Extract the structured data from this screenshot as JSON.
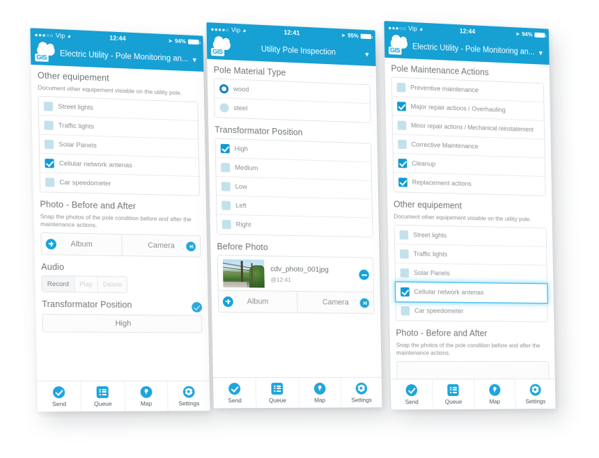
{
  "theme": {
    "brand_blue": "#16a0d4",
    "accent_blue": "#1fa5dd",
    "checkbox_on": "#0f9ad4",
    "checkbox_off": "#c3e1ec",
    "focus_glow": "#4fc3ef",
    "page_background": "#ffffff",
    "label_gray": "#8a9094"
  },
  "tabbar": {
    "items": [
      {
        "label": "Send",
        "icon": "check-circle-icon"
      },
      {
        "label": "Queue",
        "icon": "list-icon"
      },
      {
        "label": "Map",
        "icon": "map-pin-icon"
      },
      {
        "label": "Settings",
        "icon": "gear-icon"
      }
    ]
  },
  "phone1": {
    "statusbar": {
      "signal_dots": "●●●○○",
      "carrier": "Vip",
      "wifi_icon": "wifi-icon",
      "time": "12:44",
      "location_icon": "location-arrow-icon",
      "battery_percent": "94%"
    },
    "navbar": {
      "logo": "gis-cloud-logo",
      "logo_text": "GIS",
      "title": "Electric Utility - Pole Monitoring an...",
      "chevron": "chevron-down-icon"
    },
    "other_equipment": {
      "title": "Other equipement",
      "subtitle": "Document other equipement visiable on the utility pole.",
      "items": [
        {
          "label": "Street lights",
          "checked": false
        },
        {
          "label": "Traffic lights",
          "checked": false
        },
        {
          "label": "Solar Panels",
          "checked": false
        },
        {
          "label": "Cellular network antenas",
          "checked": true
        },
        {
          "label": "Car speedometer",
          "checked": false
        }
      ]
    },
    "photo": {
      "title": "Photo - Before and After",
      "subtitle": "Snap the photos of the pole condition before and after the maintenance actions.",
      "album_label": "Album",
      "album_icon": "plus-circle-icon",
      "camera_label": "Camera",
      "camera_icon": "camera-icon"
    },
    "audio": {
      "title": "Audio",
      "record_label": "Record",
      "play_label": "Play",
      "delete_label": "Delete"
    },
    "transformator": {
      "title": "Transformator Position",
      "status_icon": "check-circle-icon",
      "value": "High"
    }
  },
  "phone2": {
    "statusbar": {
      "signal_dots": "●●●●○",
      "carrier": "Vip",
      "wifi_icon": "wifi-icon",
      "time": "12:41",
      "location_icon": "location-arrow-icon",
      "battery_percent": "95%"
    },
    "navbar": {
      "logo": "gis-cloud-logo",
      "logo_text": "GIS",
      "title": "Utility Pole Inspection",
      "chevron": "chevron-down-icon"
    },
    "pole_material": {
      "title": "Pole Material Type",
      "items": [
        {
          "label": "wood",
          "selected": true
        },
        {
          "label": "steel",
          "selected": false
        }
      ]
    },
    "transformator": {
      "title": "Transformator Position",
      "items": [
        {
          "label": "High",
          "checked": true
        },
        {
          "label": "Medium",
          "checked": false
        },
        {
          "label": "Low",
          "checked": false
        },
        {
          "label": "Left",
          "checked": false
        },
        {
          "label": "Right",
          "checked": false
        }
      ]
    },
    "before_photo": {
      "title": "Before Photo",
      "thumbnail": "utility-pole-photo-thumbnail",
      "filename": "cdv_photo_001jpg",
      "timestamp": "@12:41",
      "remove_icon": "minus-circle-icon",
      "album_label": "Album",
      "album_icon": "plus-circle-icon",
      "camera_label": "Camera",
      "camera_icon": "camera-icon"
    }
  },
  "phone3": {
    "statusbar": {
      "signal_dots": "●●●○○",
      "carrier": "Vip",
      "wifi_icon": "wifi-icon",
      "time": "12:44",
      "location_icon": "location-arrow-icon",
      "battery_percent": "94%"
    },
    "navbar": {
      "logo": "gis-cloud-logo",
      "logo_text": "GIS",
      "title": "Electric Utility - Pole Monitoring an...",
      "chevron": "chevron-down-icon"
    },
    "maintenance": {
      "title": "Pole Maintenance Actions",
      "items": [
        {
          "label": "Preventive maintenance",
          "checked": false
        },
        {
          "label": "Major repair actions / Overhauling",
          "checked": true
        },
        {
          "label": "Minor repair actions / Mechanical reinstatement",
          "checked": false
        },
        {
          "label": "Corrective Maintenance",
          "checked": false
        },
        {
          "label": "Cleanup",
          "checked": true
        },
        {
          "label": "Replacement actions",
          "checked": true
        }
      ]
    },
    "other_equipment": {
      "title": "Other equipement",
      "subtitle": "Document other equipement visiable on the utility pole.",
      "items": [
        {
          "label": "Street lights",
          "checked": false,
          "focused": false
        },
        {
          "label": "Traffic lights",
          "checked": false,
          "focused": false
        },
        {
          "label": "Solar Panels",
          "checked": false,
          "focused": false
        },
        {
          "label": "Cellular network antenas",
          "checked": true,
          "focused": true
        },
        {
          "label": "Car speedometer",
          "checked": false,
          "focused": false
        }
      ]
    },
    "photo": {
      "title": "Photo - Before and After",
      "subtitle": "Snap the photos of the pole condition before and after the maintenance actions."
    }
  }
}
